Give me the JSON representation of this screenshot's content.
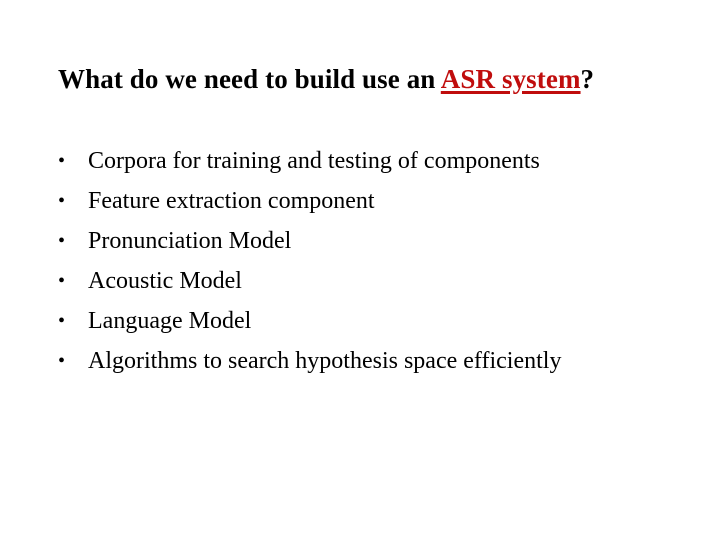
{
  "slide": {
    "background_color": "#ffffff",
    "title": {
      "plain_prefix": "What do we need to build use an ",
      "accent_text": "ASR system",
      "tail_text": "?",
      "accent_color": "#c00d0d",
      "plain_color": "#000000"
    },
    "bullets": {
      "marker": "•",
      "items": [
        {
          "label": "Corpora for training and testing of components"
        },
        {
          "label": "Feature extraction component"
        },
        {
          "label": "Pronunciation Model"
        },
        {
          "label": "Acoustic Model"
        },
        {
          "label": "Language Model"
        },
        {
          "label": "Algorithms to search hypothesis space efficiently"
        }
      ]
    }
  }
}
